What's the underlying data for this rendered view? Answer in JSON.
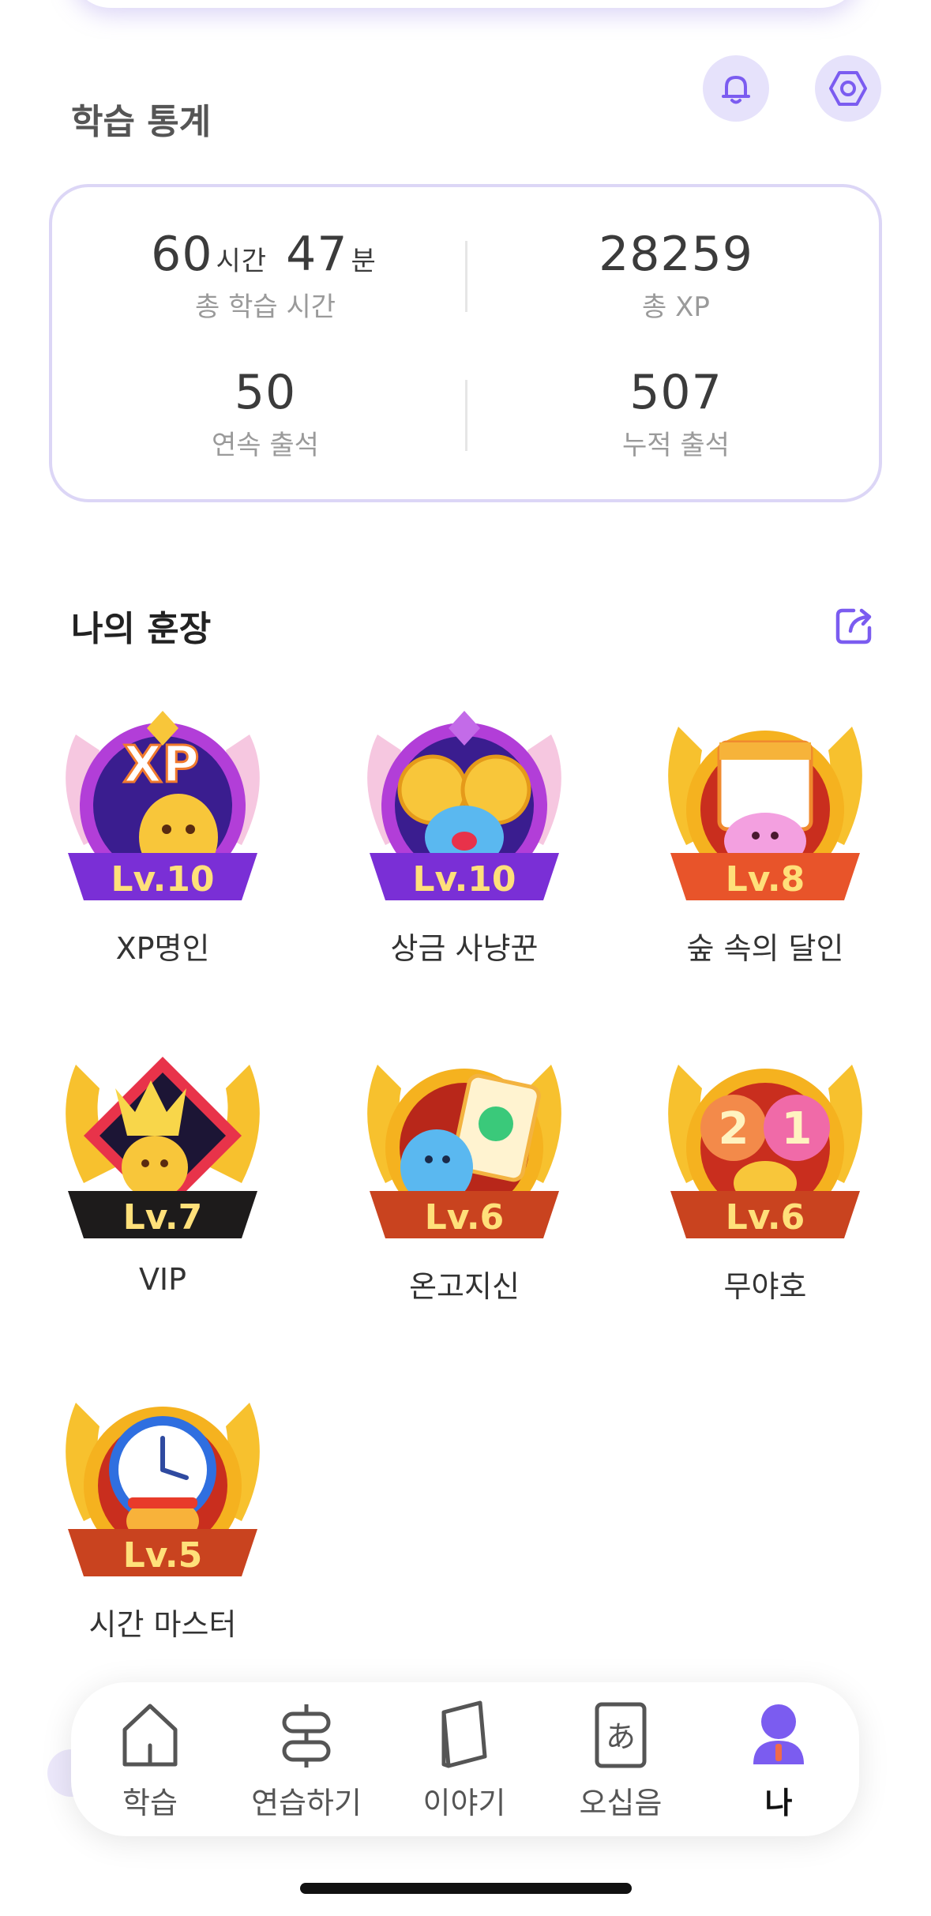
{
  "stats": {
    "title": "학습 통계",
    "hours": "60",
    "hours_unit": "시간",
    "minutes": "47",
    "minutes_unit": "분",
    "study_time_label": "총 학습 시간",
    "total_xp": "28259",
    "total_xp_label": "총 XP",
    "streak": "50",
    "streak_label": "연속 출석",
    "cumulative": "507",
    "cumulative_label": "누적 출석"
  },
  "badges": {
    "title": "나의 훈장",
    "items": [
      {
        "name": "XP명인",
        "level": "Lv.10",
        "icon": "xp-mascot"
      },
      {
        "name": "상금 사냥꾼",
        "level": "Lv.10",
        "icon": "coins-mascot"
      },
      {
        "name": "숲 속의 달인",
        "level": "Lv.8",
        "icon": "calendar-mascot"
      },
      {
        "name": "VIP",
        "level": "Lv.7",
        "icon": "crown-mascot"
      },
      {
        "name": "온고지신",
        "level": "Lv.6",
        "icon": "clipboard-mascot"
      },
      {
        "name": "무야호",
        "level": "Lv.6",
        "icon": "21-mascot"
      },
      {
        "name": "시간 마스터",
        "level": "Lv.5",
        "icon": "clock-mascot"
      }
    ]
  },
  "tabbar": {
    "items": [
      {
        "label": "학습",
        "icon": "home-icon"
      },
      {
        "label": "연습하기",
        "icon": "practice-icon"
      },
      {
        "label": "이야기",
        "icon": "book-icon"
      },
      {
        "label": "오십음",
        "icon": "kana-card-icon",
        "glyph": "あ"
      },
      {
        "label": "나",
        "icon": "profile-icon",
        "active": true
      }
    ]
  },
  "colors": {
    "accent": "#7b5cf0",
    "accent_light": "#e6e2fb",
    "card_border": "#dcd6f6",
    "gold": "#f7c12e",
    "ribbon_purple": "#7a2fd6",
    "ribbon_orange": "#e8542a",
    "ribbon_black": "#1d1b1b",
    "ribbon_brown": "#c9431f"
  }
}
